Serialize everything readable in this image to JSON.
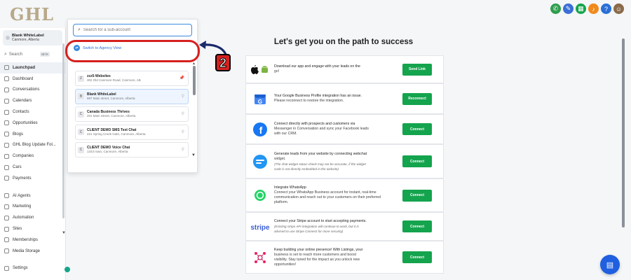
{
  "brand": {
    "logo_text": "GHL"
  },
  "topbar": {
    "icons": [
      {
        "name": "phone-icon",
        "color": "#2e9e4d",
        "glyph": "✆"
      },
      {
        "name": "megaphone-icon",
        "color": "#3b6fd6",
        "glyph": "✎"
      },
      {
        "name": "apps-icon",
        "color": "#14a44d",
        "glyph": "▦"
      },
      {
        "name": "bell-icon",
        "color": "#f08a1c",
        "glyph": "♪"
      },
      {
        "name": "help-icon",
        "color": "#2a6fd6",
        "glyph": "?"
      },
      {
        "name": "user-avatar-icon",
        "color": "#8a6a4a",
        "glyph": "☺"
      }
    ]
  },
  "sidebar": {
    "account": {
      "name": "Blank WhiteLabel",
      "location": "Canmore, Alberta"
    },
    "search": {
      "label": "Search",
      "shortcut": "ctrl K"
    },
    "items": [
      {
        "label": "Launchpad",
        "active": true
      },
      {
        "label": "Dashboard"
      },
      {
        "label": "Conversations"
      },
      {
        "label": "Calendars"
      },
      {
        "label": "Contacts"
      },
      {
        "label": "Opportunities"
      },
      {
        "label": "Blogs"
      },
      {
        "label": "GHL Blog Update Fol..."
      },
      {
        "label": "Companies"
      },
      {
        "label": "Cars"
      },
      {
        "label": "Payments"
      },
      {
        "label": "AI Agents",
        "gap": true
      },
      {
        "label": "Marketing"
      },
      {
        "label": "Automation"
      },
      {
        "label": "Sites"
      },
      {
        "label": "Memberships"
      },
      {
        "label": "Media Storage"
      },
      {
        "label": "Settings",
        "gap": true
      }
    ]
  },
  "switcher": {
    "search_placeholder": "Search for a sub-account",
    "switch_label": "Switch to Agency View",
    "accounts": [
      {
        "initial": "Z",
        "name": "zzz5-Websites",
        "address": "302 Old Canmore Road, Canmore, AB",
        "pinned": true
      },
      {
        "initial": "B",
        "name": "Blank WhiteLabel",
        "address": "997 Main street, Canmore, Alberta",
        "selected": true
      },
      {
        "initial": "C",
        "name": "Canada Business Thrives",
        "address": "201 Main Street, Canmore, Alberta"
      },
      {
        "initial": "C",
        "name": "CLIENT DEMO SMS Text Chat",
        "address": "221 Spring Creek Gate, Canmore, Alberta"
      },
      {
        "initial": "C",
        "name": "CLIENT DEMO Voice Chat",
        "address": "1343 main, Canmore, Alberta"
      }
    ]
  },
  "annotation": {
    "number": "2"
  },
  "main": {
    "title": "Let's get you on the path to success",
    "cards": [
      {
        "icon": "apple-android-icon",
        "lines": [
          "Download our app and engage with your leads on the",
          "go!"
        ],
        "note": [],
        "button": "Send Link",
        "height": 40
      },
      {
        "icon": "google-business-icon",
        "lines": [
          "Your Google Business Profile integration has an issue.",
          "Please reconnect to restore the integration."
        ],
        "note": [],
        "button": "Reconnect",
        "height": 44
      },
      {
        "icon": "facebook-icon",
        "lines": [
          "Connect directly with prospects and customers via",
          "Messenger in Conversation and sync your Facebook leads",
          "with our CRM."
        ],
        "note": [],
        "button": "Connect",
        "height": 43
      },
      {
        "icon": "webchat-icon",
        "lines": [
          "Generate leads from your website by connecting webchat",
          "widget."
        ],
        "note": [
          "(The chat widget status check may not be accurate, if the widget",
          "code is not directly embedded in the website)"
        ],
        "button": "Connect",
        "height": 49
      },
      {
        "icon": "whatsapp-icon",
        "lines": [
          "Integrate WhatsApp",
          "Connect your WhatsApp Business account for instant, real-time",
          "communication and reach out to your customers on their preferred",
          "platform."
        ],
        "note": [],
        "button": "Connect",
        "height": 48
      },
      {
        "icon": "stripe-icon",
        "lines": [
          "Connect your Stripe account to start accepting payments."
        ],
        "note": [
          "(Existing stripe API integration will continue to work, but it is",
          "advised to use Stripe Connect for more security)"
        ],
        "button": "Connect",
        "height": 41
      },
      {
        "icon": "listings-icon",
        "lines": [
          "Keep building your online presence! With Listings, your",
          "business is set to reach more customers and boost",
          "visibility. Stay tuned for the impact as you unlock new",
          "opportunities!"
        ],
        "note": [],
        "button": "Connect",
        "height": 47
      }
    ]
  },
  "chat_button_icon": "chat-icon"
}
